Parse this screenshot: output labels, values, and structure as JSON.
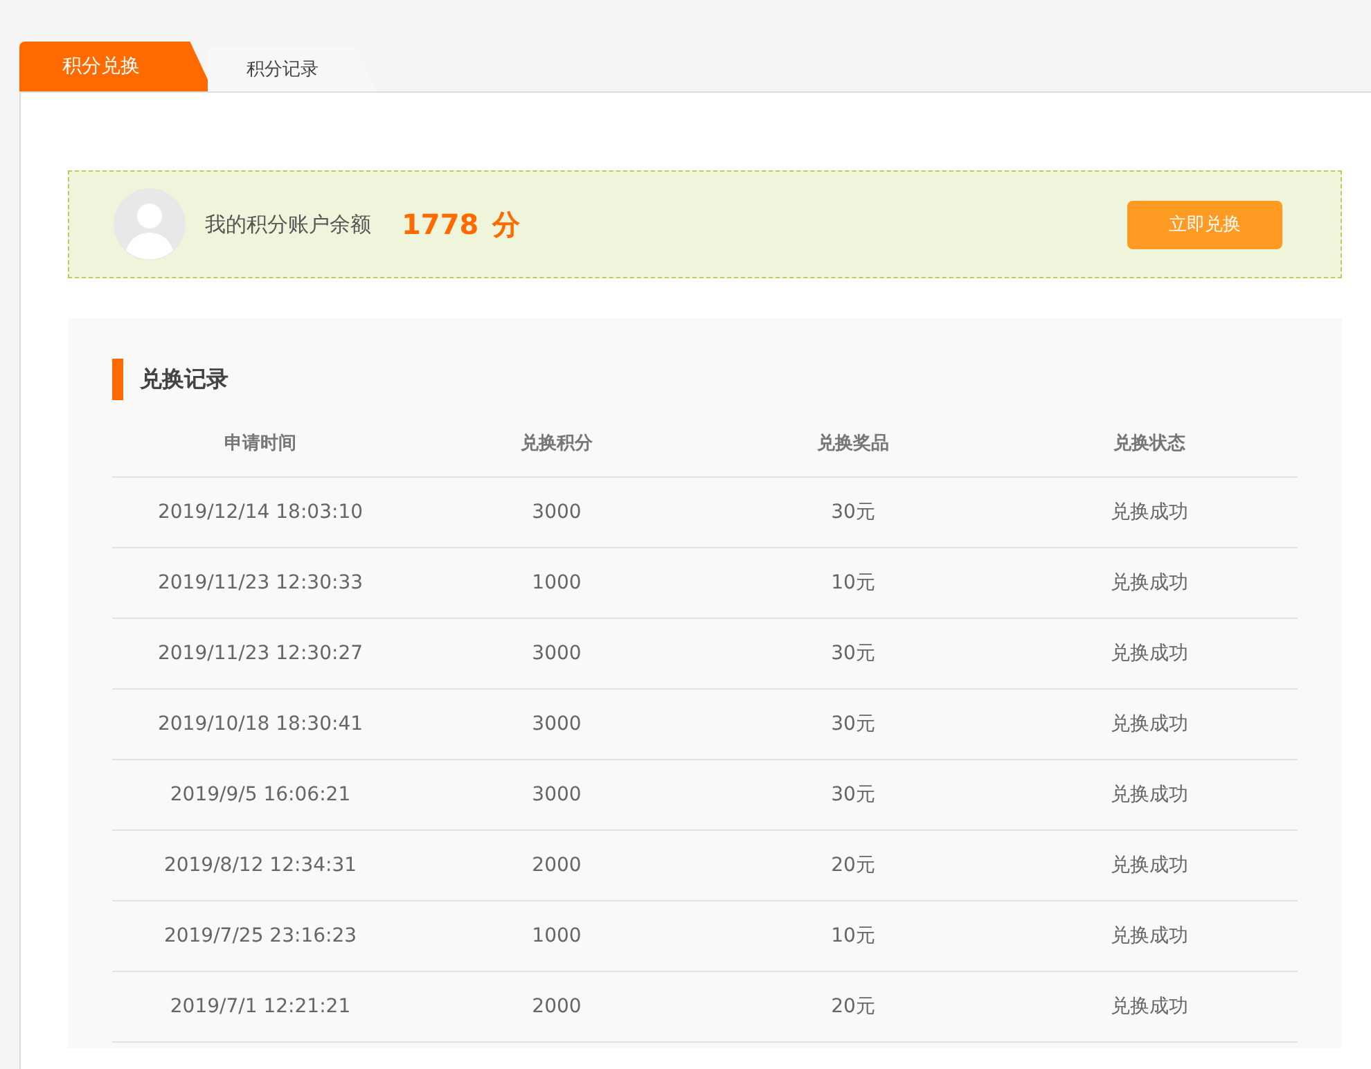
{
  "tabs": [
    {
      "label": "积分兑换",
      "selected": true
    },
    {
      "label": "积分记录",
      "selected": false
    }
  ],
  "account": {
    "label": "我的积分账户余额",
    "points": "1778",
    "unit": "分",
    "button": "立即兑换"
  },
  "records": {
    "title": "兑换记录",
    "columns": [
      "申请时间",
      "兑换积分",
      "兑换奖品",
      "兑换状态"
    ],
    "rows": [
      [
        "2019/12/14 18:03:10",
        "3000",
        "30元",
        "兑换成功"
      ],
      [
        "2019/11/23 12:30:33",
        "1000",
        "10元",
        "兑换成功"
      ],
      [
        "2019/11/23 12:30:27",
        "3000",
        "30元",
        "兑换成功"
      ],
      [
        "2019/10/18 18:30:41",
        "3000",
        "30元",
        "兑换成功"
      ],
      [
        "2019/9/5 16:06:21",
        "3000",
        "30元",
        "兑换成功"
      ],
      [
        "2019/8/12 12:34:31",
        "2000",
        "20元",
        "兑换成功"
      ],
      [
        "2019/7/25 23:16:23",
        "1000",
        "10元",
        "兑换成功"
      ],
      [
        "2019/7/1 12:21:21",
        "2000",
        "20元",
        "兑换成功"
      ]
    ]
  }
}
